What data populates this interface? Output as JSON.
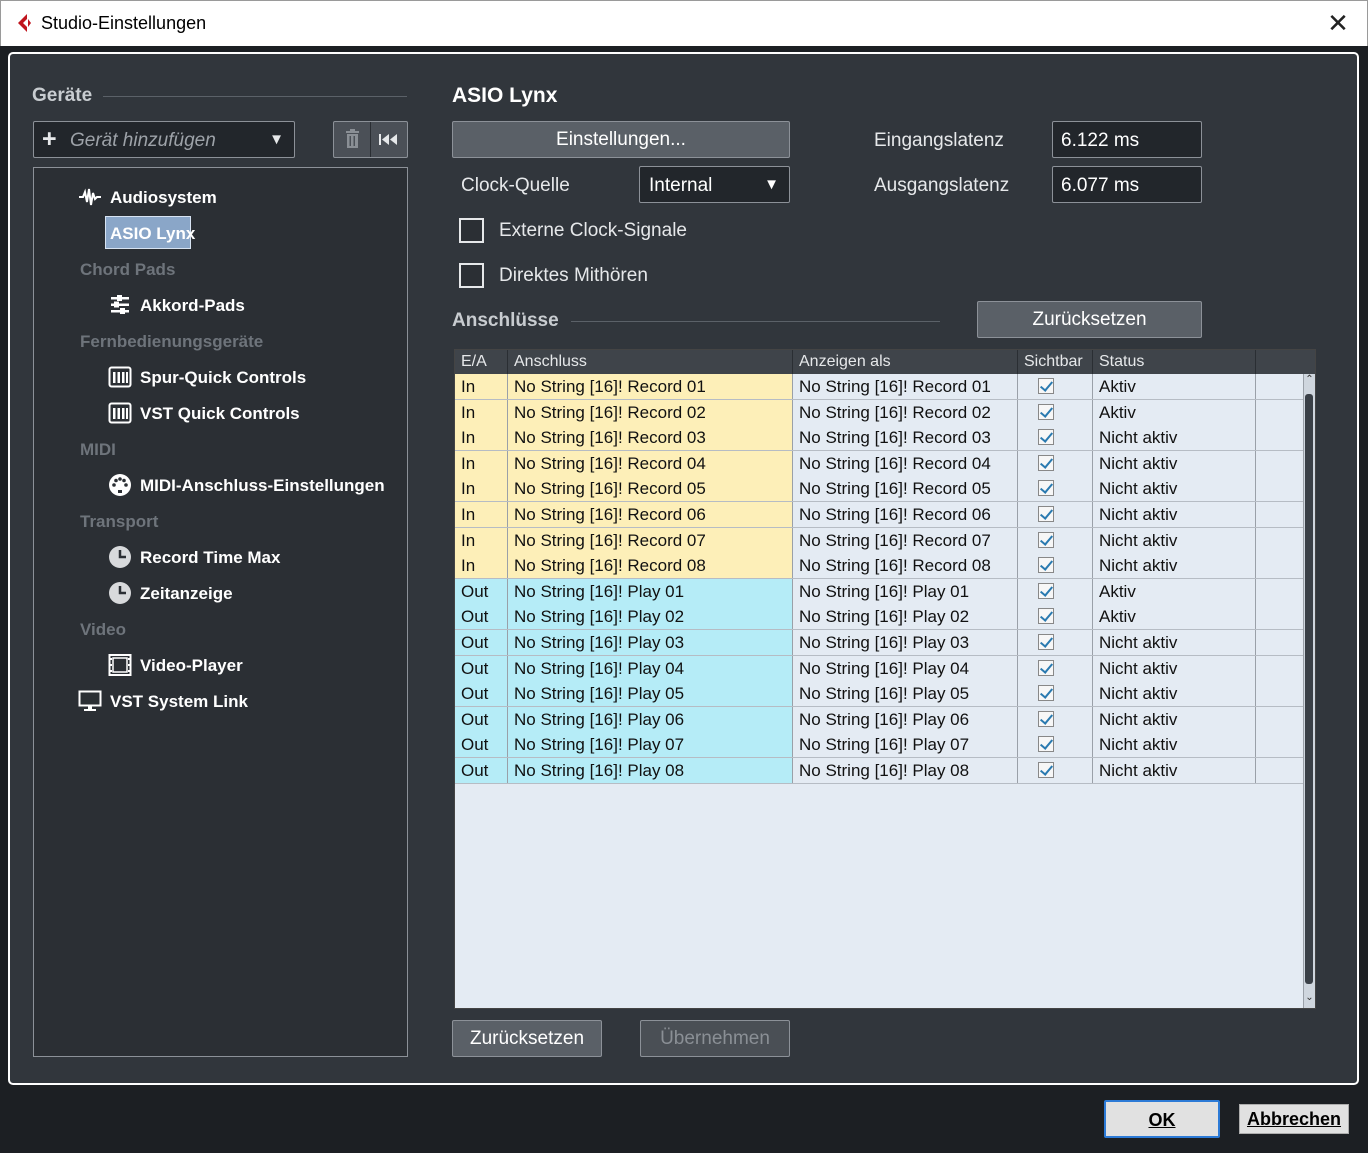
{
  "window": {
    "title": "Studio-Einstellungen",
    "close_glyph": "✕"
  },
  "left": {
    "section_title": "Geräte",
    "add_device_placeholder": "Gerät hinzufügen",
    "tree": [
      {
        "kind": "item",
        "label": "Audiosystem",
        "icon": "waveform-icon"
      },
      {
        "kind": "item",
        "label": "ASIO Lynx",
        "selected": true
      },
      {
        "kind": "category",
        "label": "Chord Pads"
      },
      {
        "kind": "item",
        "label": "Akkord-Pads",
        "icon": "chord-pads-icon"
      },
      {
        "kind": "category",
        "label": "Fernbedienungsgeräte"
      },
      {
        "kind": "item",
        "label": "Spur-Quick Controls",
        "icon": "controller-icon"
      },
      {
        "kind": "item",
        "label": "VST Quick Controls",
        "icon": "controller-icon"
      },
      {
        "kind": "category",
        "label": "MIDI"
      },
      {
        "kind": "item",
        "label": "MIDI-Anschluss-Einstellungen",
        "icon": "midi-port-icon"
      },
      {
        "kind": "category",
        "label": "Transport"
      },
      {
        "kind": "item",
        "label": "Record Time Max",
        "icon": "clock-icon"
      },
      {
        "kind": "item",
        "label": "Zeitanzeige",
        "icon": "clock-icon"
      },
      {
        "kind": "category",
        "label": "Video"
      },
      {
        "kind": "item",
        "label": "Video-Player",
        "icon": "film-icon"
      },
      {
        "kind": "item",
        "label": "VST System Link",
        "icon": "monitor-icon"
      }
    ]
  },
  "right": {
    "title": "ASIO Lynx",
    "settings_button": "Einstellungen...",
    "input_latency_label": "Eingangslatenz",
    "input_latency_value": "6.122 ms",
    "output_latency_label": "Ausgangslatenz",
    "output_latency_value": "6.077 ms",
    "clock_label": "Clock-Quelle",
    "clock_value": "Internal",
    "external_clock_label": "Externe Clock-Signale",
    "direct_monitoring_label": "Direktes Mithören",
    "ports_title": "Anschlüsse",
    "reset_top_button": "Zurücksetzen",
    "table": {
      "headers": [
        "E/A",
        "Anschluss",
        "Anzeigen als",
        "Sichtbar",
        "Status"
      ],
      "rows": [
        {
          "io": "In",
          "port": "No String [16]! Record 01",
          "display": "No String [16]! Record 01",
          "visible": true,
          "status": "Aktiv"
        },
        {
          "io": "In",
          "port": "No String [16]! Record 02",
          "display": "No String [16]! Record 02",
          "visible": true,
          "status": "Aktiv"
        },
        {
          "io": "In",
          "port": "No String [16]! Record 03",
          "display": "No String [16]! Record 03",
          "visible": true,
          "status": "Nicht aktiv"
        },
        {
          "io": "In",
          "port": "No String [16]! Record 04",
          "display": "No String [16]! Record 04",
          "visible": true,
          "status": "Nicht aktiv"
        },
        {
          "io": "In",
          "port": "No String [16]! Record 05",
          "display": "No String [16]! Record 05",
          "visible": true,
          "status": "Nicht aktiv"
        },
        {
          "io": "In",
          "port": "No String [16]! Record 06",
          "display": "No String [16]! Record 06",
          "visible": true,
          "status": "Nicht aktiv"
        },
        {
          "io": "In",
          "port": "No String [16]! Record 07",
          "display": "No String [16]! Record 07",
          "visible": true,
          "status": "Nicht aktiv"
        },
        {
          "io": "In",
          "port": "No String [16]! Record 08",
          "display": "No String [16]! Record 08",
          "visible": true,
          "status": "Nicht aktiv"
        },
        {
          "io": "Out",
          "port": "No String [16]! Play 01",
          "display": "No String [16]! Play 01",
          "visible": true,
          "status": "Aktiv"
        },
        {
          "io": "Out",
          "port": "No String [16]! Play 02",
          "display": "No String [16]! Play 02",
          "visible": true,
          "status": "Aktiv"
        },
        {
          "io": "Out",
          "port": "No String [16]! Play 03",
          "display": "No String [16]! Play 03",
          "visible": true,
          "status": "Nicht aktiv"
        },
        {
          "io": "Out",
          "port": "No String [16]! Play 04",
          "display": "No String [16]! Play 04",
          "visible": true,
          "status": "Nicht aktiv"
        },
        {
          "io": "Out",
          "port": "No String [16]! Play 05",
          "display": "No String [16]! Play 05",
          "visible": true,
          "status": "Nicht aktiv"
        },
        {
          "io": "Out",
          "port": "No String [16]! Play 06",
          "display": "No String [16]! Play 06",
          "visible": true,
          "status": "Nicht aktiv"
        },
        {
          "io": "Out",
          "port": "No String [16]! Play 07",
          "display": "No String [16]! Play 07",
          "visible": true,
          "status": "Nicht aktiv"
        },
        {
          "io": "Out",
          "port": "No String [16]! Play 08",
          "display": "No String [16]! Play 08",
          "visible": true,
          "status": "Nicht aktiv"
        }
      ]
    },
    "reset_bottom_button": "Zurücksetzen",
    "apply_button": "Übernehmen"
  },
  "footer": {
    "ok_button": "OK",
    "cancel_button": "Abbrechen"
  },
  "colors": {
    "in_row": "#fdefb8",
    "out_row": "#b5ecf7",
    "panel": "#31363c",
    "selected": "#8aa6c8"
  }
}
